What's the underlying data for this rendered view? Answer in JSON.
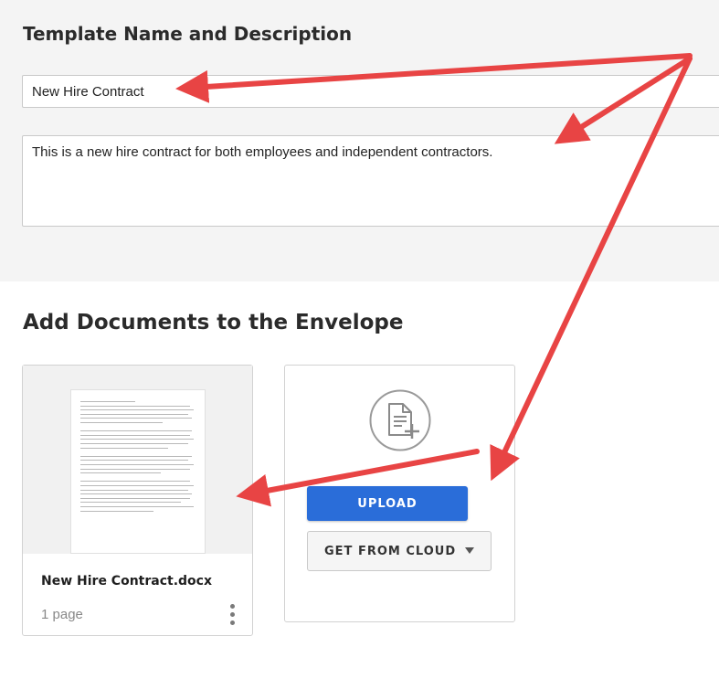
{
  "template_section": {
    "title": "Template Name and Description",
    "name_value": "New Hire Contract",
    "description_value": "This is a new hire contract for both employees and independent contractors."
  },
  "documents_section": {
    "title": "Add Documents to the Envelope",
    "document": {
      "name": "New Hire Contract.docx",
      "pages": "1 page"
    },
    "upload": {
      "icon": "add-document-icon",
      "upload_label": "UPLOAD",
      "cloud_label": "GET FROM CLOUD",
      "cloud_icon": "caret-down-icon"
    }
  },
  "colors": {
    "accent": "#2a6dd9",
    "annotation_arrow": "#e84444",
    "top_band": "#f4f4f4"
  }
}
